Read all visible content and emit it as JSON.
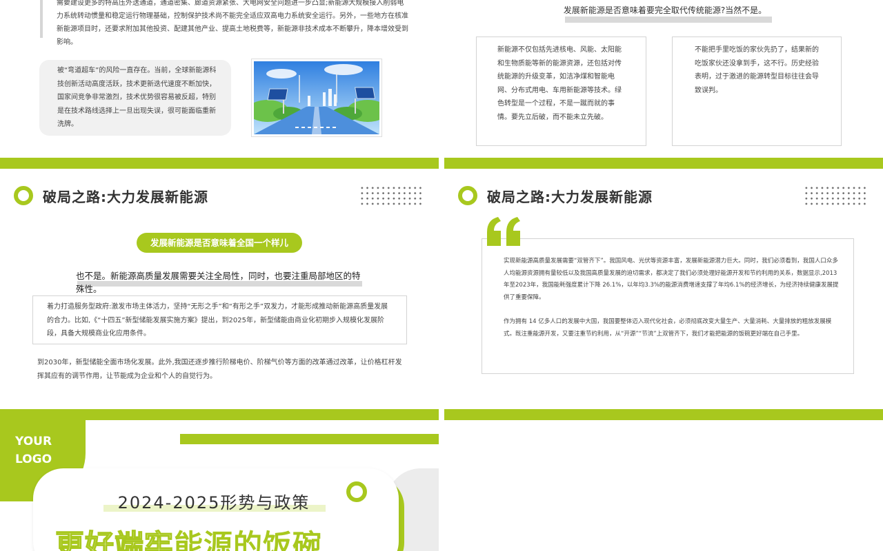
{
  "colors": {
    "accent": "#a8c81e",
    "grey_band": "#d9d9d9",
    "text": "#333333"
  },
  "slide1": {
    "top_text": "需要建设更多的特高压外送通道，通道密集、廊道资源紧张、大电网安全问题进一步凸显;新能源大规模接入削弱电力系统转动惯量和稳定运行物理基础，控制保护技术尚不能完全适应双高电力系统安全运行。另外，一些地方在核准新能源项目时，还要求附加其他投资、配建其他产业、提高土地税费等，新能源非技术成本不断攀升，降本增效受到影响。",
    "card_text": "被“弯道超车”的风险一直存在。当前，全球新能源科技创新活动高度活跃，技术更新迭代速度不断加快，国家间竞争非常激烈，技术优势很容易被反超，特别是在技术路线选择上一旦出现失误，很可能面临重新洗牌。"
  },
  "slide2": {
    "heading": "发展新能源是否意味着要完全取代传统能源?当然不是。",
    "box_left": "新能源不仅包括先进核电、风能、太阳能和生物质能等新的能源资源，还包括对传统能源的升级变革，如洁净煤和智能电网、分布式用电、车用新能源等技术。绿色转型是一个过程，不是一蹴而就的事情。要先立后破，而不能未立先破。",
    "box_right": "不能把手里吃饭的家伙先扔了，结果新的吃饭家伙还没拿到手，这不行。历史经验表明，过于激进的能源转型目标往往会导致误判。"
  },
  "slide3": {
    "title": "破局之路:大力发展新能源",
    "pill": "发展新能源是否意味着全国一个样儿",
    "subtitle": "也不是。新能源高质量发展需要关注全局性，同时，也要注重局部地区的特殊性。",
    "box_text": "着力打造服务型政府:激发市场主体活力，坚持“无形之手”和“有形之手”双发力，才能形成推动新能源高质量发展的合力。比如,《“十四五”新型储能发展实施方案》提出，到2025年，新型储能由商业化初期步入规模化发展阶段，具备大规模商业化应用条件。",
    "bottom_text": "到2030年，新型储能全面市场化发展。此外,我国还逐步推行阶梯电价、阶梯气价等方面的改革通过改革，让价格杠杆发挥其应有的调节作用，让节能成为企业和个人的自觉行为。"
  },
  "slide4": {
    "title": "破局之路:大力发展新能源",
    "para1": "实现新能源高质量发展需要“双管齐下”。我国风电、光伏等资源丰富，发展新能源潜力巨大。同时，我们必须看到，我国人口众多人均能源资源拥有量较低以及我国高质量发展的迫切需求，都决定了我们必须处理好能源开发和节约利用的关系，数据显示,2013年至2023年，我国能耗强度累计下降 26.1%，以年均3.3%的能源消费增速支撑了年均6.1%的经济增长，为经济持续健康发展提供了重要保障。",
    "para2": "作为拥有 14 亿多人口的发展中大国，我国要整体迈入现代化社会，必须彻底改变大量生产、大量消耗、大量排放的粗放发展模式。既注重能源开发，又要注重节约利用，从“开源”“节流”上双管齐下，我们才能把能源的饭碗更好端在自己手里。"
  },
  "slide5": {
    "logo_line1": "YOUR",
    "logo_line2": "LOGO",
    "year_title": "2024-2025形势与政策",
    "big_title_outline": "更好端牢",
    "big_title_solid": "能源的饭碗"
  }
}
